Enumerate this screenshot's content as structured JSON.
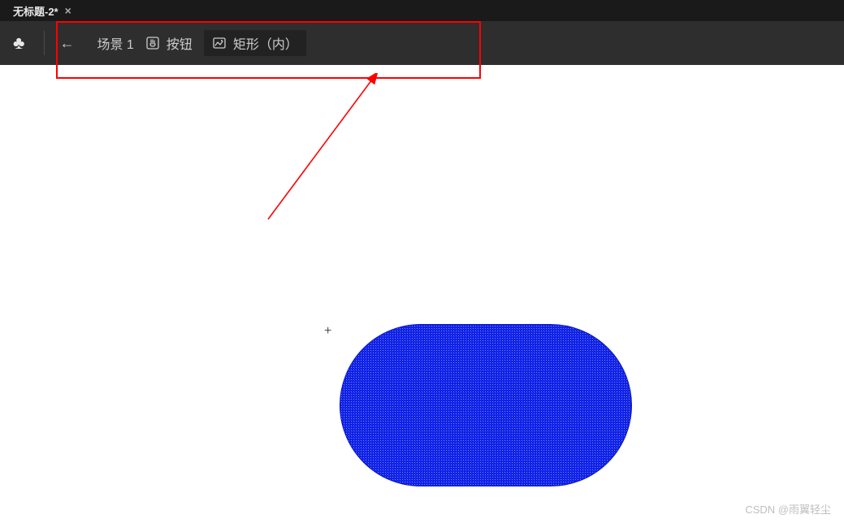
{
  "tab": {
    "title": "无标题-2*",
    "close_label": "×"
  },
  "toolbar": {
    "club_glyph": "♣",
    "back_glyph": "←"
  },
  "breadcrumb": {
    "scene": {
      "label": "场景 1"
    },
    "button": {
      "label": "按钮"
    },
    "shape": {
      "label": "矩形（内）"
    }
  },
  "canvas": {
    "registration": "+",
    "shape_fill": "#0b1ee6"
  },
  "annotation": {
    "highlight_color": "#ff0000"
  },
  "watermark": {
    "text": "CSDN @雨翼轻尘"
  }
}
